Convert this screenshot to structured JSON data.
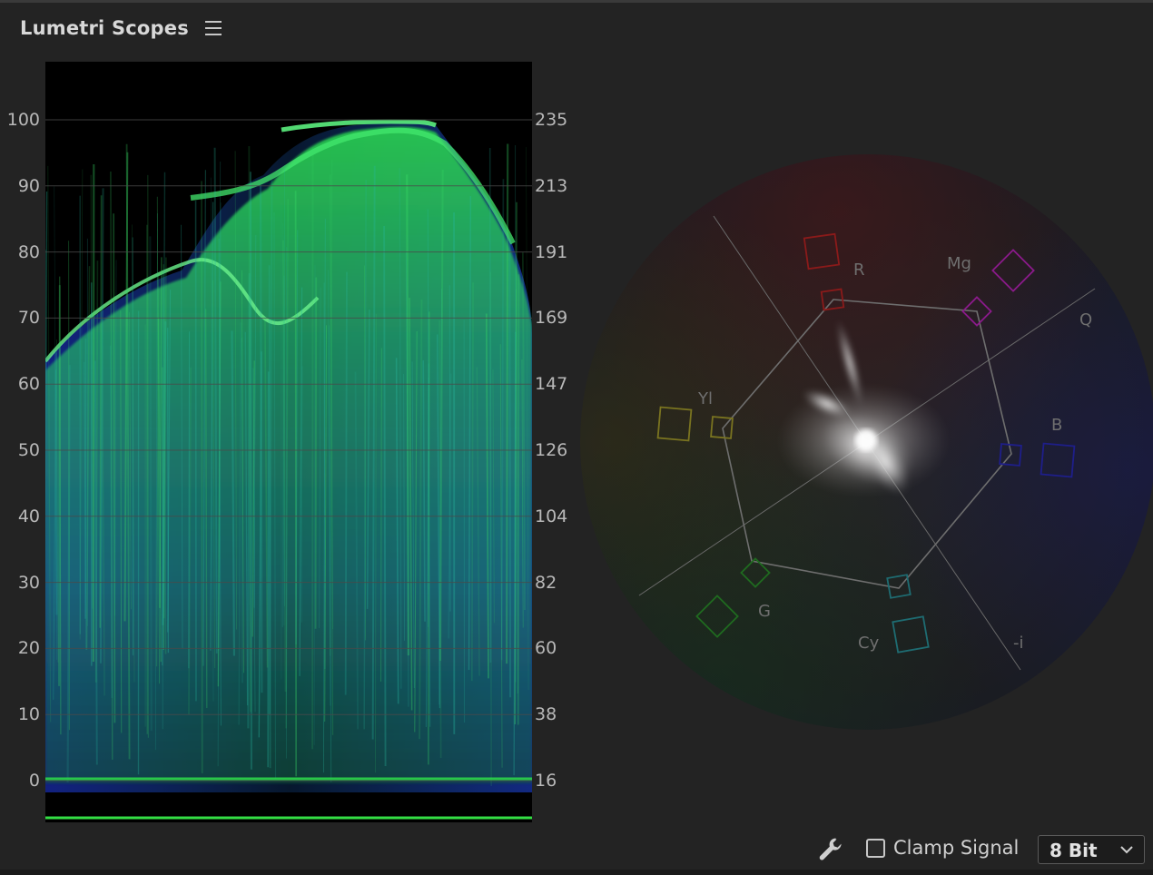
{
  "panel": {
    "title": "Lumetri Scopes",
    "menu_icon": "hamburger-menu-icon"
  },
  "waveform": {
    "ire_scale": [
      "100",
      "90",
      "80",
      "70",
      "60",
      "50",
      "40",
      "30",
      "20",
      "10",
      "0"
    ],
    "code_scale": [
      "235",
      "213",
      "191",
      "169",
      "147",
      "126",
      "104",
      "82",
      "60",
      "38",
      "16"
    ]
  },
  "vectorscope": {
    "labels": {
      "r": "R",
      "mg": "Mg",
      "q": "Q",
      "yl": "Yl",
      "b": "B",
      "g": "G",
      "cy": "Cy",
      "neg_i": "-i"
    },
    "colors": {
      "r": "#8a1a1a",
      "mg": "#8a1a8a",
      "yl": "#7a7420",
      "b": "#1e1e8a",
      "g": "#1f6a1f",
      "cy": "#1e6c72"
    }
  },
  "footer": {
    "settings_icon": "wrench-icon",
    "clamp_signal_label": "Clamp Signal",
    "clamp_signal_checked": false,
    "bit_depth_value": "8 Bit"
  }
}
